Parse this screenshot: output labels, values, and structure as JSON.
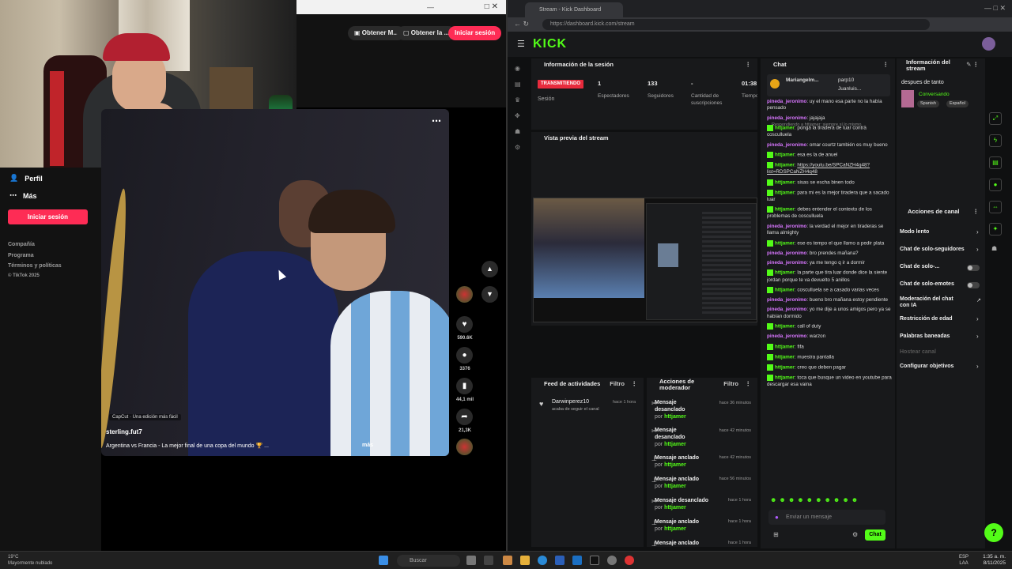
{
  "tiktok": {
    "top_buttons": {
      "obtener1": "Obtener M...",
      "obtener2": "Obtener la ...",
      "login": "Iniciar sesión"
    },
    "sidebar": {
      "perfil": "Perfil",
      "mas": "Más",
      "login": "Iniciar sesión",
      "links": [
        "Compañía",
        "Programa",
        "Términos y políticas",
        "© TikTok 2025"
      ]
    },
    "video": {
      "capcut": "CapCut · Una edición más fácil",
      "author": "sterling.fut7",
      "description": "Argentina vs Francia - La mejor final de una copa del mundo 🏆 ...",
      "more": "más"
    },
    "counts": {
      "likes": "590.6K",
      "comments": "3376",
      "saves": "44,1 mil",
      "shares": "21,3K"
    }
  },
  "kick": {
    "tab_title": "Stream - Kick Dashboard",
    "url": "https://dashboard.kick.com/stream",
    "logo": "KICK",
    "session": {
      "title": "Información de la sesión",
      "status": "TRANSMITIENDO",
      "status_label": "Sesión",
      "stats": [
        {
          "value": "1",
          "label": "Espectadores"
        },
        {
          "value": "133",
          "label": "Seguidores"
        },
        {
          "value": "-",
          "label": "Cantidad de suscripciones"
        },
        {
          "value": "01:38",
          "label": "Tiempo en vivo"
        }
      ]
    },
    "preview_title": "Vista previa del stream",
    "activity": {
      "title": "Feed de actividades",
      "filter": "Filtro",
      "item_user": "Darwinperez10",
      "item_text": "acaba de seguir el canal",
      "item_time": "hace 1 hora"
    },
    "moderator": {
      "title": "Acciones de moderador",
      "filter": "Filtro",
      "by": "por",
      "rows": [
        {
          "action": "Mensaje desanclado",
          "user": "httjamer",
          "time": "hace 36 minutos"
        },
        {
          "action": "Mensaje desanclado",
          "user": "httjamer",
          "time": "hace 42 minutos"
        },
        {
          "action": "Mensaje anclado",
          "user": "httjamer",
          "time": "hace 42 minutos"
        },
        {
          "action": "Mensaje anclado",
          "user": "httjamer",
          "time": "hace 56 minutos"
        },
        {
          "action": "Mensaje desanclado",
          "user": "httjamer",
          "time": "hace 1 hora"
        },
        {
          "action": "Mensaje anclado",
          "user": "httjamer",
          "time": "hace 1 hora"
        },
        {
          "action": "Mensaje anclado",
          "user": "httjamer",
          "time": "hace 1 hora"
        }
      ]
    },
    "chat": {
      "title": "Chat",
      "pinned_user1": "Mariangelm...",
      "pinned_user2": "parp10",
      "pinned_user3": "Juanluis...",
      "reply_note": "Respondiendo a httjamer: siempre sí lo mismo ...",
      "messages": [
        {
          "user": "pineda_jeronimo",
          "type": "p",
          "text": "uy el mano esa parte no la había pensado"
        },
        {
          "user": "pineda_jeronimo",
          "type": "p",
          "text": "jajajaja"
        },
        {
          "user": "httjamer",
          "type": "h",
          "text": "ponga la tiradera de luar contra cosculluela"
        },
        {
          "user": "pineda_jeronimo",
          "type": "p",
          "text": "omar courtz también es muy bueno"
        },
        {
          "user": "httjamer",
          "type": "h",
          "text": "esa es la de anuel"
        },
        {
          "user": "httjamer",
          "type": "h",
          "link": "https://youtu.be/SPCaNZH4q48?list=RDSPCaNZH4q48"
        },
        {
          "user": "httjamer",
          "type": "h",
          "text": "sisas se escha binen todo"
        },
        {
          "user": "httjamer",
          "type": "h",
          "text": "para mi es la mejor tiradera que a sacado luar"
        },
        {
          "user": "httjamer",
          "type": "h",
          "text": "debes entender el contexto de los problemas de cosculluela"
        },
        {
          "user": "pineda_jeronimo",
          "type": "p",
          "text": "la verdad el mejor en tiraderas se llama almighty"
        },
        {
          "user": "httjamer",
          "type": "h",
          "text": "ese es tempo el que llamo a pedir plata"
        },
        {
          "user": "pineda_jeronimo",
          "type": "p",
          "text": "bro prendes mañana?"
        },
        {
          "user": "pineda_jeronimo",
          "type": "p",
          "text": "ya me tengo q ir a dormir"
        },
        {
          "user": "httjamer",
          "type": "h",
          "text": "la parte que tira luar donde dice la siente jordan porque te va devuelto 5 anillos"
        },
        {
          "user": "httjamer",
          "type": "h",
          "text": "cosculluela se a casado varias veces"
        },
        {
          "user": "pineda_jeronimo",
          "type": "p",
          "text": "bueno bro mañana estoy pendiente"
        },
        {
          "user": "pineda_jeronimo",
          "type": "p",
          "text": "yo me dije a unos amigos pero ya se habían dormido"
        },
        {
          "user": "httjamer",
          "type": "h",
          "text": "call of duty"
        },
        {
          "user": "pineda_jeronimo",
          "type": "p",
          "text": "warzon"
        },
        {
          "user": "httjamer",
          "type": "h",
          "text": "fifa"
        },
        {
          "user": "httjamer",
          "type": "h",
          "text": "muestra pantalla"
        },
        {
          "user": "httjamer",
          "type": "h",
          "text": "creo que deben pagar"
        },
        {
          "user": "httjamer",
          "type": "h",
          "text": "toca que busque un video en youtube para descargar esa vaina"
        }
      ],
      "input_placeholder": "Enviar un mensaje",
      "send_button": "Chat"
    },
    "stream_info": {
      "title": "Información del stream",
      "stream_title": "despues de tanto",
      "category": "Conversando",
      "tags": [
        "Spanish",
        "Español"
      ]
    },
    "channel_actions": {
      "title": "Acciones de canal",
      "items": [
        {
          "label": "Modo lento",
          "kind": "arrow"
        },
        {
          "label": "Chat de solo-seguidores",
          "kind": "arrow"
        },
        {
          "label": "Chat de solo-...",
          "kind": "toggle"
        },
        {
          "label": "Chat de solo-emotes",
          "kind": "toggle"
        },
        {
          "label": "Moderación del chat con IA",
          "kind": "ext"
        },
        {
          "label": "Restricción de edad",
          "kind": "arrow"
        },
        {
          "label": "Palabras baneadas",
          "kind": "arrow"
        },
        {
          "label": "Hostear canal",
          "kind": "disabled"
        },
        {
          "label": "Configurar objetivos",
          "kind": "arrow"
        }
      ]
    }
  },
  "taskbar": {
    "search": "Buscar",
    "weather": "19°C",
    "weather_sub": "Mayormente nublado",
    "lang": "ESP",
    "lang_sub": "LAA",
    "time": "1:35 a. m.",
    "date": "8/11/2025"
  }
}
